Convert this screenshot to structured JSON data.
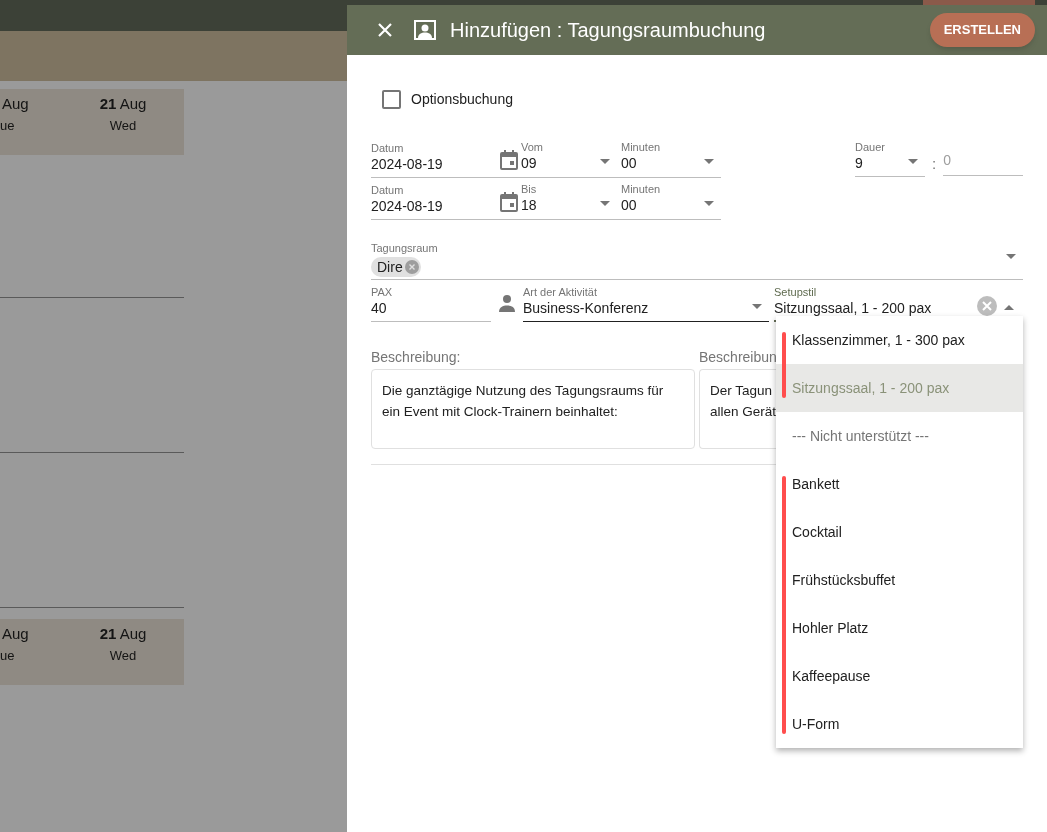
{
  "background": {
    "day_headers": [
      {
        "days": [
          {
            "date": "Aug",
            "weekday": "ue"
          },
          {
            "date": "**21** Aug",
            "weekday": "Wed"
          }
        ]
      },
      {
        "days": [
          {
            "date": "Aug",
            "weekday": "ue"
          },
          {
            "date": "**21** Aug",
            "weekday": "Wed"
          }
        ]
      }
    ]
  },
  "dialog": {
    "title": "Hinzufügen : Tagungsraumbuchung",
    "create_button": "ERSTELLEN",
    "option_booking": {
      "label": "Optionsbuchung",
      "checked": false
    },
    "time_rows": [
      {
        "date_label": "Datum",
        "date": "2024-08-19",
        "hour_label": "Vom",
        "hour": "09",
        "minute_label": "Minuten",
        "minute": "00"
      },
      {
        "date_label": "Datum",
        "date": "2024-08-19",
        "hour_label": "Bis",
        "hour": "18",
        "minute_label": "Minuten",
        "minute": "00"
      }
    ],
    "duration": {
      "label": "Dauer",
      "hours": "9",
      "separator": ":",
      "minutes": "0"
    },
    "room": {
      "label": "Tagungsraum",
      "chips": [
        "Dire"
      ]
    },
    "pax": {
      "label": "PAX",
      "value": "40"
    },
    "activity": {
      "label": "Art der Aktivität",
      "value": "Business-Konferenz"
    },
    "setup_style": {
      "label": "Setupstil",
      "value": "Sitzungssaal, 1 - 200 pax",
      "expanded": true,
      "options": [
        {
          "kind": "option",
          "label": "Klassenzimmer, 1 - 300 pax",
          "selected": false,
          "flagged": true
        },
        {
          "kind": "option",
          "label": "Sitzungssaal, 1 - 200 pax",
          "selected": true,
          "flagged": true
        },
        {
          "kind": "header",
          "label": "--- Nicht unterstützt ---"
        },
        {
          "kind": "option",
          "label": "Bankett",
          "selected": false,
          "flagged": true
        },
        {
          "kind": "option",
          "label": "Cocktail",
          "selected": false,
          "flagged": true
        },
        {
          "kind": "option",
          "label": "Frühstücksbuffet",
          "selected": false,
          "flagged": true
        },
        {
          "kind": "option",
          "label": "Hohler Platz",
          "selected": false,
          "flagged": true
        },
        {
          "kind": "option",
          "label": "Kaffeepause",
          "selected": false,
          "flagged": true
        },
        {
          "kind": "option",
          "label": "U-Form",
          "selected": false,
          "flagged": true
        }
      ]
    },
    "descriptions": [
      {
        "label": "Beschreibung:",
        "lines": [
          "Die ganztägige Nutzung des Tagungsraums für",
          "ein Event mit Clock-Trainern beinhaltet:"
        ]
      },
      {
        "label": "Beschreibun",
        "lines": [
          "Der Tagun",
          "allen Gerät"
        ]
      }
    ]
  }
}
